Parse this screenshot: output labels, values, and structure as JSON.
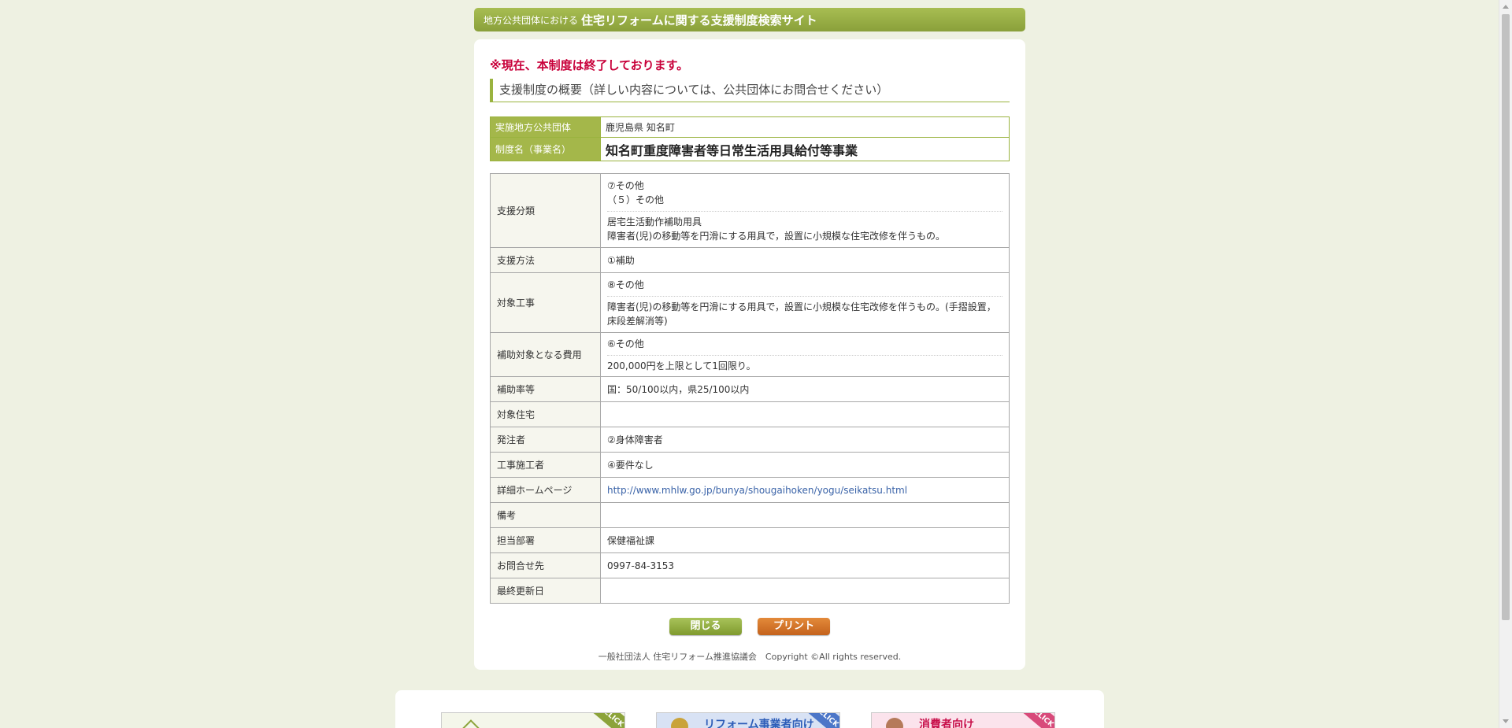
{
  "header": {
    "prefix": "地方公共団体における",
    "title": "住宅リフォームに関する支援制度検索サイト"
  },
  "notice": "※現在、本制度は終了しております。",
  "section_title": "支援制度の概要（詳しい内容については、公共団体にお問合せください）",
  "summary": {
    "org_label": "実施地方公共団体",
    "org_value": "鹿児島県 知名町",
    "name_label": "制度名（事業名）",
    "name_value": "知名町重度障害者等日常生活用具給付等事業"
  },
  "details": {
    "support_category": {
      "label": "支援分類",
      "line1": "⑦その他",
      "line2": "（５）その他",
      "line3": "居宅生活動作補助用具",
      "line4": "障害者(児)の移動等を円滑にする用具で，設置に小規模な住宅改修を伴うもの。"
    },
    "support_method": {
      "label": "支援方法",
      "value": "①補助"
    },
    "target_work": {
      "label": "対象工事",
      "line1": "⑧その他",
      "line2": "障害者(児)の移動等を円滑にする用具で，設置に小規模な住宅改修を伴うもの。(手摺設置，",
      "line3": "床段差解消等)"
    },
    "eligible_cost": {
      "label": "補助対象となる費用",
      "line1": "⑥その他",
      "line2": "200,000円を上限として1回限り。"
    },
    "subsidy_rate": {
      "label": "補助率等",
      "value": "国：50/100以内，県25/100以内"
    },
    "target_housing": {
      "label": "対象住宅",
      "value": ""
    },
    "orderer": {
      "label": "発注者",
      "value": "②身体障害者"
    },
    "contractor": {
      "label": "工事施工者",
      "value": "④要件なし"
    },
    "homepage": {
      "label": "詳細ホームページ",
      "value": "http://www.mhlw.go.jp/bunya/shougaihoken/yogu/seikatsu.html"
    },
    "remarks": {
      "label": "備考",
      "value": ""
    },
    "department": {
      "label": "担当部署",
      "value": "保健福祉課"
    },
    "contact": {
      "label": "お問合せ先",
      "value": "0997-84-3153"
    },
    "last_updated": {
      "label": "最終更新日",
      "value": ""
    }
  },
  "buttons": {
    "close": "閉じる",
    "print": "プリント"
  },
  "footer": "一般社団法人 住宅リフォーム推進協議会　Copyright ©All rights reserved.",
  "banners": {
    "b1_label": "",
    "b2_label": "リフォーム事業者向け",
    "b3_label": "消費者向け",
    "click": "CLICK"
  }
}
